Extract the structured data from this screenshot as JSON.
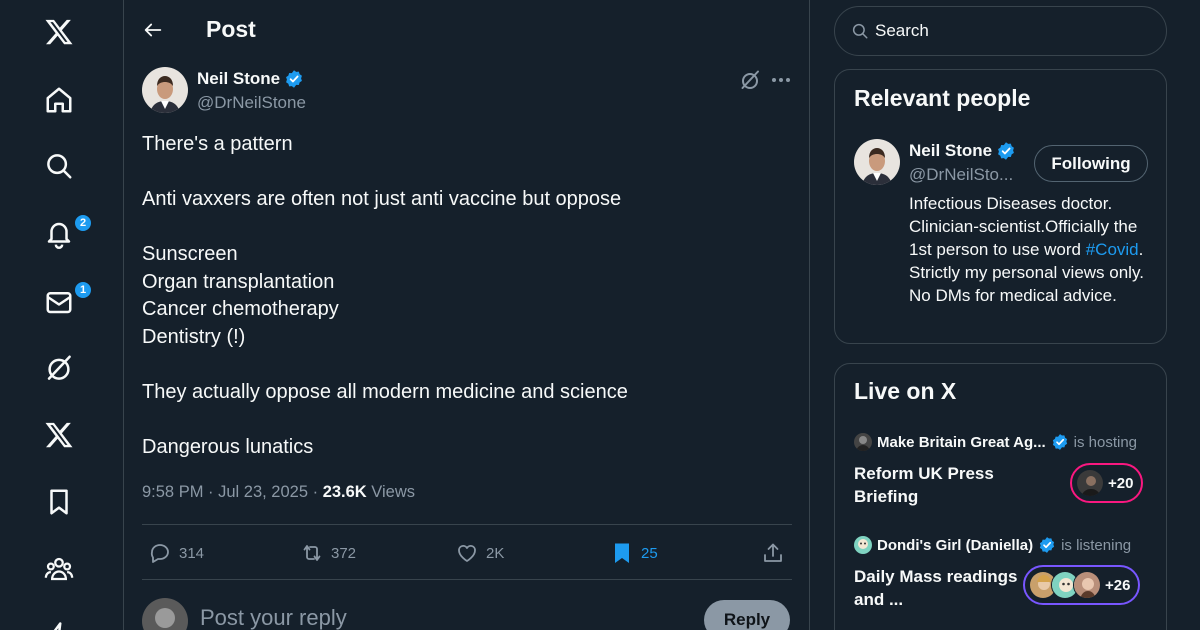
{
  "nav": {
    "items": [
      {
        "icon": "x-logo-icon"
      },
      {
        "icon": "home-icon"
      },
      {
        "icon": "search-icon"
      },
      {
        "icon": "bell-icon",
        "badge": "2"
      },
      {
        "icon": "mail-icon",
        "badge": "1"
      },
      {
        "icon": "grok-icon"
      },
      {
        "icon": "x-premium-icon"
      },
      {
        "icon": "bookmark-icon"
      },
      {
        "icon": "communities-icon"
      },
      {
        "icon": "lightning-icon"
      }
    ]
  },
  "header": {
    "title": "Post"
  },
  "post": {
    "author_name": "Neil Stone",
    "author_handle": "@DrNeilStone",
    "lines": [
      "There's a pattern",
      "Anti vaxxers are often not just anti vaccine but oppose",
      "Sunscreen",
      "Organ transplantation",
      "Cancer chemotherapy",
      "Dentistry (!)",
      "They actually oppose all modern medicine and science",
      "Dangerous lunatics"
    ],
    "timestamp": "9:58 PM · Jul 23, 2025 · ",
    "views_count": "23.6K",
    "views_label": " Views",
    "stats": {
      "replies": "314",
      "reposts": "372",
      "likes": "2K",
      "bookmarks": "25"
    }
  },
  "reply": {
    "placeholder": "Post your reply",
    "button": "Reply"
  },
  "search": {
    "placeholder": "Search"
  },
  "relevant": {
    "title": "Relevant people",
    "name": "Neil Stone",
    "handle": "@DrNeilSto...",
    "follow_label": "Following",
    "bio_part1": "Infectious Diseases doctor. Clinician-scientist.Officially the 1st person to use word ",
    "bio_hashtag": "#Covid",
    "bio_part2": ". Strictly my personal views only. No DMs for medical advice."
  },
  "live": {
    "title": "Live on X",
    "spaces": [
      {
        "host": "Make Britain Great Ag...",
        "status": "is hosting",
        "title": "Reform UK Press Briefing",
        "count": "+20",
        "ring_color": "#f91880"
      },
      {
        "host": "Dondi's Girl (Daniella)",
        "status": "is listening",
        "title": "Daily Mass readings and ...",
        "count": "+26",
        "ring_color": "#7856ff"
      }
    ]
  },
  "colors": {
    "accent": "#1d9bf0",
    "background": "#15202b",
    "muted": "#8b98a5",
    "border": "#38444d"
  }
}
